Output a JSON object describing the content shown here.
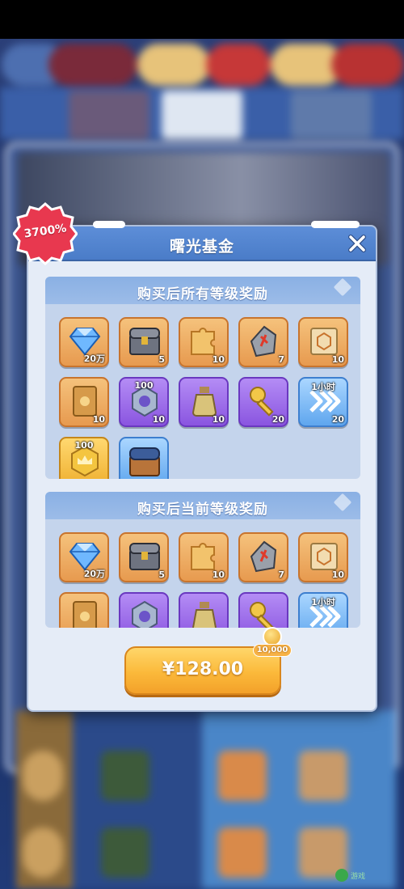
{
  "modal": {
    "title": "曙光基金",
    "discount_badge": "3700%",
    "close_icon": "close-icon"
  },
  "section_all": {
    "title": "购买后所有等级奖励",
    "items": [
      {
        "icon": "diamond-icon",
        "qty": "20万",
        "color": "orange"
      },
      {
        "icon": "treasure-chest-icon",
        "qty": "5",
        "color": "orange"
      },
      {
        "icon": "puzzle-piece-icon",
        "qty": "10",
        "color": "orange"
      },
      {
        "icon": "rune-stone-icon",
        "qty": "7",
        "color": "orange"
      },
      {
        "icon": "scroll-icon",
        "qty": "10",
        "color": "orange"
      },
      {
        "icon": "card-icon",
        "qty": "10",
        "color": "orange"
      },
      {
        "icon": "gear-token-icon",
        "qty": "10",
        "top": "100",
        "color": "purple"
      },
      {
        "icon": "potion-bottle-icon",
        "qty": "10",
        "color": "purple"
      },
      {
        "icon": "key-icon",
        "qty": "20",
        "color": "purple"
      },
      {
        "icon": "speedup-arrows-icon",
        "qty": "20",
        "top": "1小时",
        "color": "blue"
      },
      {
        "icon": "crown-token-icon",
        "qty": "",
        "top": "100",
        "color": "gold"
      },
      {
        "icon": "blue-chest-icon",
        "qty": "",
        "color": "blue"
      }
    ]
  },
  "section_current": {
    "title": "购买后当前等级奖励",
    "items": [
      {
        "icon": "diamond-icon",
        "qty": "20万",
        "color": "orange"
      },
      {
        "icon": "treasure-chest-icon",
        "qty": "5",
        "color": "orange"
      },
      {
        "icon": "puzzle-piece-icon",
        "qty": "10",
        "color": "orange"
      },
      {
        "icon": "rune-stone-icon",
        "qty": "7",
        "color": "orange"
      },
      {
        "icon": "scroll-icon",
        "qty": "10",
        "color": "orange"
      },
      {
        "icon": "card-icon",
        "qty": "",
        "color": "orange"
      },
      {
        "icon": "gear-token-icon",
        "qty": "",
        "color": "purple"
      },
      {
        "icon": "potion-bottle-icon",
        "qty": "",
        "color": "purple"
      },
      {
        "icon": "key-icon",
        "qty": "",
        "color": "purple"
      },
      {
        "icon": "speedup-arrows-icon",
        "qty": "",
        "top": "1小时",
        "color": "blue"
      }
    ]
  },
  "purchase": {
    "price": "¥128.00",
    "bonus": "10,000"
  },
  "colors": {
    "header": "#4a7cc8",
    "button": "#fbb93a",
    "badge": "#e8384f"
  }
}
